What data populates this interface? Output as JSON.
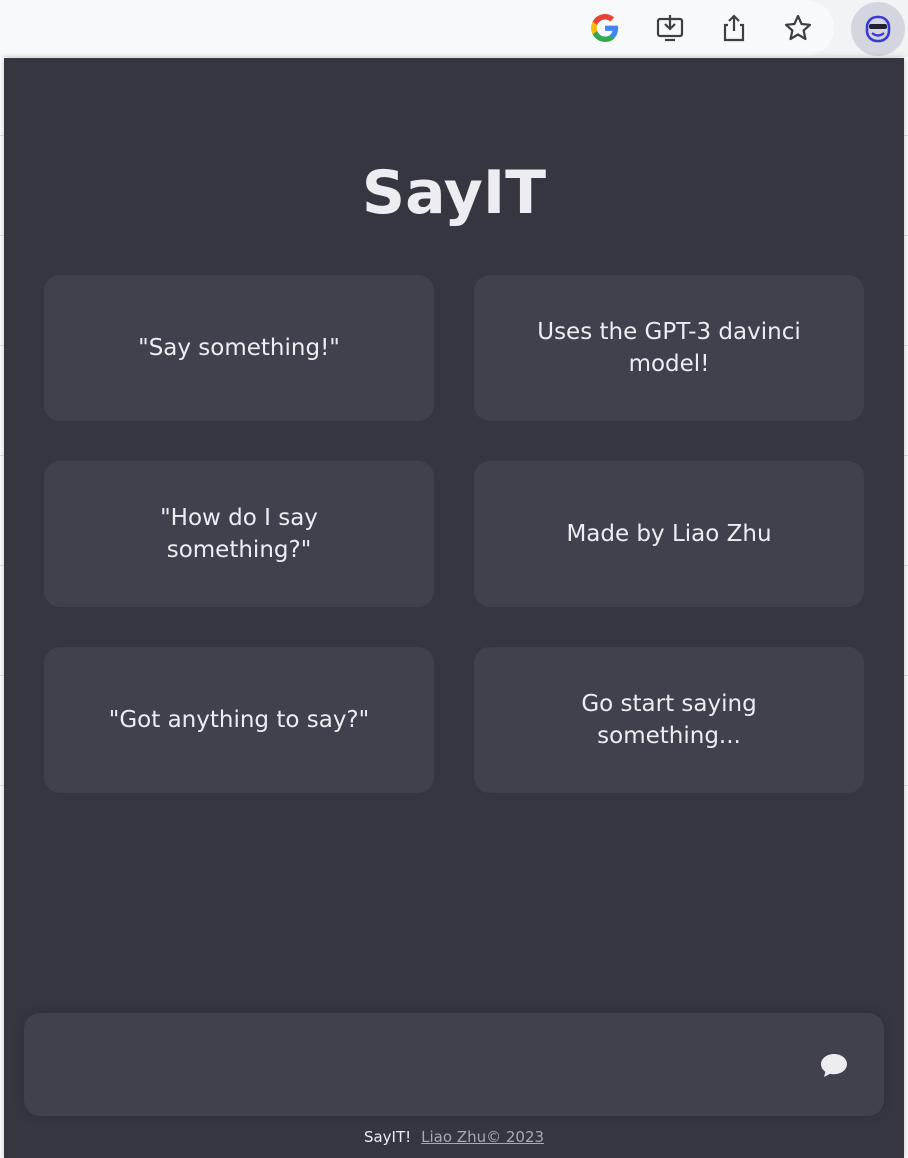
{
  "browser": {
    "toolbar_icons": [
      "google-icon",
      "install-app-icon",
      "share-icon",
      "bookmark-star-icon"
    ],
    "extension_icon": "extension-face-icon"
  },
  "app": {
    "title": "SayIT",
    "cards": [
      {
        "text": "\"Say something!\""
      },
      {
        "text": "Uses the GPT-3 davinci model!"
      },
      {
        "text": "\"How do I say something?\""
      },
      {
        "text": "Made by Liao Zhu"
      },
      {
        "text": "\"Got anything to say?\""
      },
      {
        "text": "Go start saying something..."
      }
    ],
    "input": {
      "value": "",
      "placeholder": ""
    },
    "send_icon": "chat-bubble-icon",
    "footer": {
      "brand": "SayIT!",
      "link_text": "Liao Zhu© 2023"
    }
  },
  "colors": {
    "background": "#363641",
    "card": "#41414e",
    "text": "#ececf1",
    "footer_link": "#a9a9b6"
  }
}
